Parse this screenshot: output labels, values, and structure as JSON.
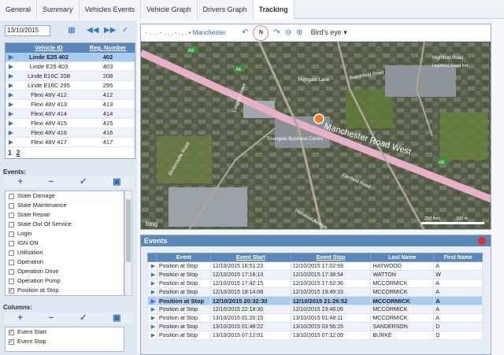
{
  "tabs": [
    "General",
    "Summary",
    "Vehicles Events",
    "Vehicle Graph",
    "Drivers Graph",
    "Tracking"
  ],
  "active_tab": 5,
  "date": "13/10/2015",
  "vehicles": {
    "columns": [
      "Vehicle ID",
      "Reg. Number"
    ],
    "rows": [
      {
        "id": "Linde E25 402",
        "reg": "402",
        "selected": true
      },
      {
        "id": "Linde E25 403",
        "reg": "403"
      },
      {
        "id": "Linde E16C 208",
        "reg": "208"
      },
      {
        "id": "Linde E16C 295",
        "reg": "295"
      },
      {
        "id": "Flexi 48V 412",
        "reg": "412"
      },
      {
        "id": "Flexi 48V 413",
        "reg": "413"
      },
      {
        "id": "Flexi 48V 414",
        "reg": "414"
      },
      {
        "id": "Flexi 48V 415",
        "reg": "415"
      },
      {
        "id": "Flexi 48V 416",
        "reg": "416"
      },
      {
        "id": "Flexi 48V 417",
        "reg": "417"
      }
    ],
    "pages": [
      "1",
      "2"
    ]
  },
  "events_filter": {
    "label": "Events:",
    "items": [
      {
        "label": "State Damage",
        "checked": false
      },
      {
        "label": "State Maintenance",
        "checked": false
      },
      {
        "label": "State Repair",
        "checked": false
      },
      {
        "label": "State Out Of Service",
        "checked": false
      },
      {
        "label": "Login",
        "checked": false
      },
      {
        "label": "IGN ON",
        "checked": false
      },
      {
        "label": "Utilisation",
        "checked": false
      },
      {
        "label": "Operation",
        "checked": false
      },
      {
        "label": "Operation Drive",
        "checked": false
      },
      {
        "label": "Operation Pump",
        "checked": false
      },
      {
        "label": "Position at Stop",
        "checked": true
      }
    ]
  },
  "columns_filter": {
    "label": "Columns:",
    "items": [
      {
        "label": "Event Start",
        "checked": true
      },
      {
        "label": "Event Stop",
        "checked": true
      }
    ]
  },
  "map": {
    "breadcrumb": "- . . . - . . . - . . . • Manchester",
    "view_mode": "Bird's eye",
    "compass_label": "N",
    "provider": "bing",
    "scale_labels": [
      "250 feet",
      "100 m"
    ],
    "labels": {
      "main_road": "Manchester Road West",
      "business_centre": "Towngate Business Centre",
      "a6_1": "A6",
      "a6_2": "A6",
      "a6_3": "A6",
      "highgate_lane": "Highgate Lane",
      "highfield_road": "Highfield Road",
      "highfield_road_2": "Highfield Road Ind.",
      "beechfield_road": "Beechfield Road",
      "carrfield_road": "Carrfield Road",
      "longley_street": "Longley Street",
      "hallstead_avenue": "Hallstead Avenue",
      "bickerstaffe": "Bickerstaffe Road"
    },
    "marker_color": "#f07a1e"
  },
  "events_table": {
    "title": "Events",
    "columns": [
      "Event",
      "Event Start",
      "Event Stop",
      "Last Name",
      "First Name"
    ],
    "rows": [
      {
        "event": "Position at Stop",
        "start": "12/10/2015 16:51:23",
        "stop": "12/10/2015 17:02:59",
        "last": "HAYWOOD",
        "first": "A"
      },
      {
        "event": "Position at Stop",
        "start": "12/10/2015 17:16:13",
        "stop": "12/10/2015 17:38:54",
        "last": "WATTON",
        "first": "W"
      },
      {
        "event": "Position at Stop",
        "start": "12/10/2015 17:42:15",
        "stop": "12/10/2015 17:52:36",
        "last": "MCCORMICK",
        "first": "A"
      },
      {
        "event": "Position at Stop",
        "start": "12/10/2015 18:14:08",
        "stop": "12/10/2015 19:49:33",
        "last": "MCCORMICK",
        "first": "A"
      },
      {
        "event": "Position at Stop",
        "start": "12/10/2015 20:32:30",
        "stop": "12/10/2015 21:26:52",
        "last": "MCCORMICK",
        "first": "A",
        "selected": true
      },
      {
        "event": "Position at Stop",
        "start": "12/10/2015 22:18:30",
        "stop": "12/10/2015 23:46:06",
        "last": "MCCORMICK",
        "first": "A"
      },
      {
        "event": "Position at Stop",
        "start": "13/10/2015 01:20:15",
        "stop": "13/10/2015 01:48:11",
        "last": "MCCORMICK",
        "first": "A"
      },
      {
        "event": "Position at Stop",
        "start": "13/10/2015 01:48:22",
        "stop": "13/10/2015 03:56:15",
        "last": "SANDERSON",
        "first": "D"
      },
      {
        "event": "Position at Stop",
        "start": "13/10/2015 07:12:01",
        "stop": "13/10/2015 07:12:09",
        "last": "BURKE",
        "first": "D"
      }
    ]
  }
}
